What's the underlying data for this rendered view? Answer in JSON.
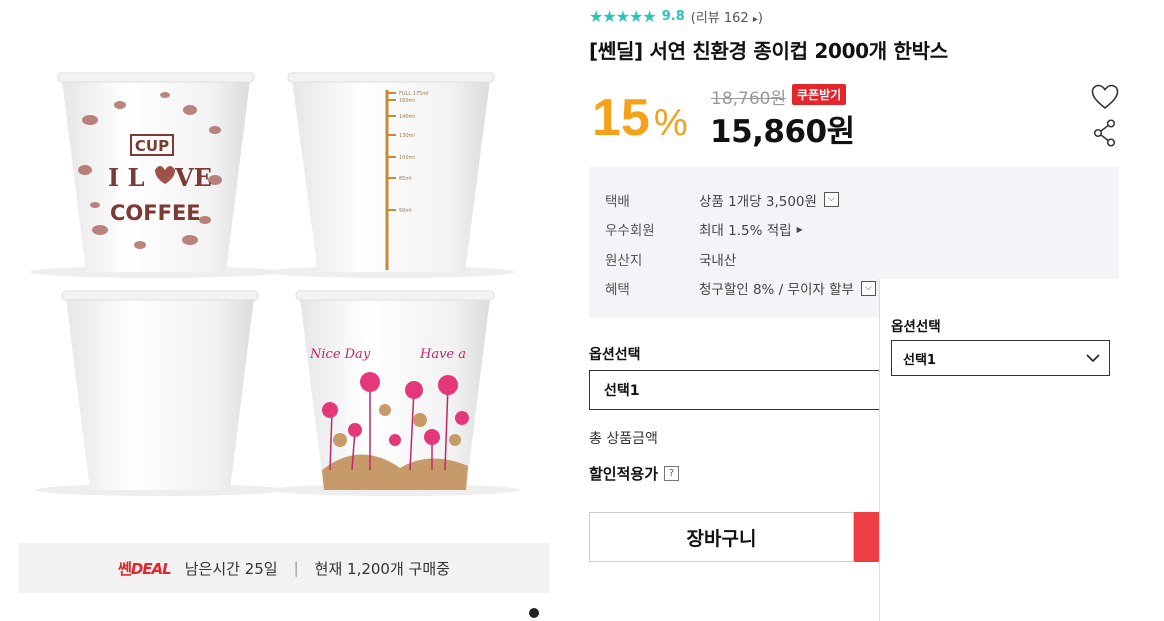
{
  "gallery": {
    "deal_logo_a": "쎈",
    "deal_logo_b": "DEAL",
    "time_left": "남은시간 25일",
    "separator": "|",
    "buying_now": "현재 1,200개 구매중",
    "cup_texts": {
      "cup": "CUP",
      "love": "I L",
      "love2": "VE",
      "coffee": "COFFEE",
      "nice_day": "Nice Day",
      "have_a": "Have a"
    },
    "measure_marks": [
      "FULL 175ml",
      "160ml",
      "140ml",
      "130ml",
      "100ml",
      "85ml",
      "50ml"
    ]
  },
  "product": {
    "stars": "★★★★★",
    "score": "9.8",
    "review": "(리뷰 162",
    "review_arrow": "▸",
    "review_close": ")",
    "title": "[쎈딜] 서연 친환경 종이컵 2000개 한박스",
    "discount": "15",
    "discount_unit": "%",
    "original_price": "18,760원",
    "coupon": "쿠폰받기",
    "price": "15,860원"
  },
  "info": [
    {
      "label": "택배",
      "value": "상품 1개당 3,500원",
      "extra": "select"
    },
    {
      "label": "우수회원",
      "value": "최대 1.5% 적립",
      "extra": "arrow"
    },
    {
      "label": "원산지",
      "value": "국내산",
      "extra": ""
    },
    {
      "label": "혜택",
      "value": "청구할인 8% / 무이자 할부",
      "extra": "select"
    }
  ],
  "options": {
    "label": "옵션선택",
    "selected": "선택1",
    "total_label": "총 상품금액",
    "discount_label": "할인적용가",
    "qmark": "?",
    "cart_button": "장바구니"
  },
  "float_panel": {
    "label": "옵션선택",
    "selected": "선택1"
  },
  "colors": {
    "accent_teal": "#2cc4b5",
    "discount_orange": "#f5a21b",
    "brand_red": "#e4262c"
  }
}
